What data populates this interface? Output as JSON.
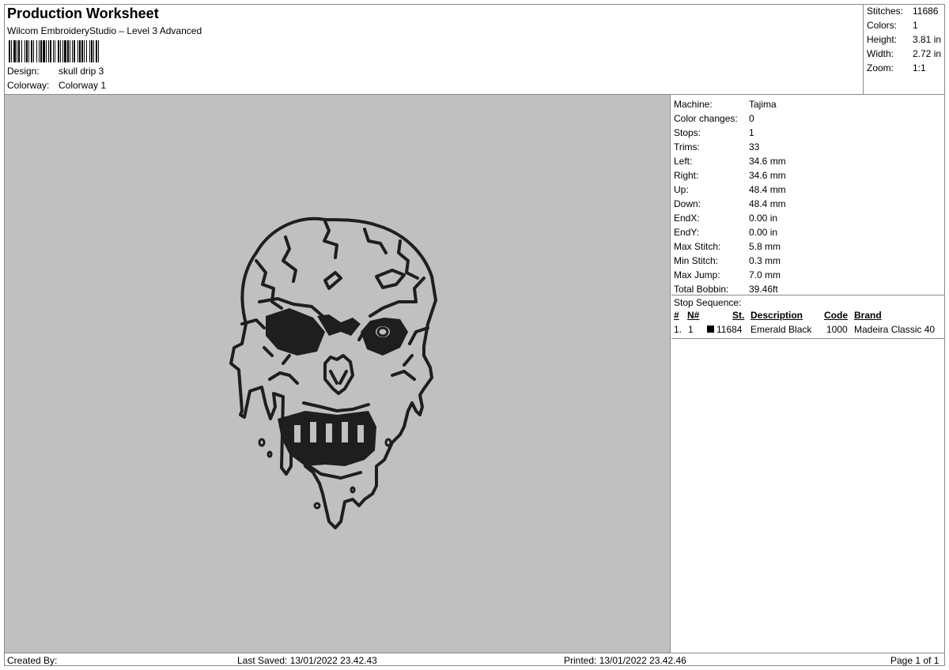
{
  "header": {
    "title": "Production Worksheet",
    "subtitle": "Wilcom EmbroideryStudio – Level 3 Advanced",
    "design_label": "Design:",
    "design_value": "skull drip 3",
    "colorway_label": "Colorway:",
    "colorway_value": "Colorway 1"
  },
  "stats": [
    {
      "label": "Stitches:",
      "value": "11686"
    },
    {
      "label": "Colors:",
      "value": "1"
    },
    {
      "label": "Height:",
      "value": "3.81 in"
    },
    {
      "label": "Width:",
      "value": "2.72 in"
    },
    {
      "label": "Zoom:",
      "value": "1:1"
    }
  ],
  "details": [
    {
      "label": "Machine:",
      "value": "Tajima"
    },
    {
      "label": "Color changes:",
      "value": "0"
    },
    {
      "label": "Stops:",
      "value": "1"
    },
    {
      "label": "Trims:",
      "value": "33"
    },
    {
      "label": "Left:",
      "value": "34.6 mm"
    },
    {
      "label": "Right:",
      "value": "34.6 mm"
    },
    {
      "label": "Up:",
      "value": "48.4 mm"
    },
    {
      "label": "Down:",
      "value": "48.4 mm"
    },
    {
      "label": "EndX:",
      "value": "0.00 in"
    },
    {
      "label": "EndY:",
      "value": "0.00 in"
    },
    {
      "label": "Max Stitch:",
      "value": "5.8 mm"
    },
    {
      "label": "Min Stitch:",
      "value": "0.3 mm"
    },
    {
      "label": "Max Jump:",
      "value": "7.0 mm"
    },
    {
      "label": "Total Bobbin:",
      "value": "39.46ft"
    }
  ],
  "stop_sequence": {
    "title": "Stop Sequence:",
    "columns": {
      "num": "#",
      "needle": "N#",
      "stitches": "St.",
      "description": "Description",
      "code": "Code",
      "brand": "Brand"
    },
    "rows": [
      {
        "num": "1.",
        "needle": "1",
        "swatch_color": "#000000",
        "stitches": "11684",
        "description": "Emerald Black",
        "code": "1000",
        "brand": "Madeira Classic 40"
      }
    ]
  },
  "footer": {
    "created_by": "Created By:",
    "last_saved": "Last Saved: 13/01/2022 23.42.43",
    "printed": "Printed: 13/01/2022 23.42.46",
    "page": "Page 1 of 1"
  },
  "colors": {
    "canvas_bg": "#c0c0c0",
    "thread": "#1e1e1e",
    "border": "#8a8a8a"
  }
}
